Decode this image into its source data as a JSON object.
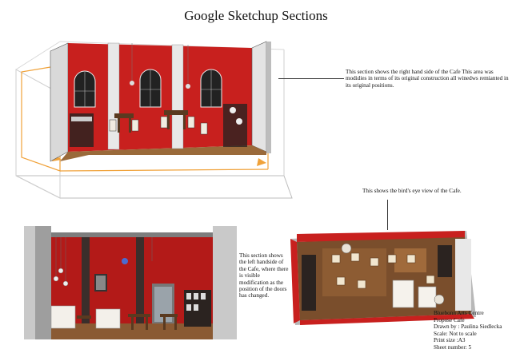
{
  "title": "Google Sketchup Sections",
  "annotations": {
    "right_section": "This section shows the right hand side of the Cafe This area was modidies in terms of its original construction all winedws remianted in its original positions.",
    "birds_eye": "This shows the bird's eye view of the  Cafe.",
    "left_section": "This section shows the left handside of the Cafe, where there is visible modification as the position of the doors has changed."
  },
  "info_block": {
    "lines": [
      "Bluebonn Arts Centre",
      "Propose Cafe",
      "Drawn by : Paulina Siedlecka",
      "Scale: Not to scale",
      "Print size :A3",
      "Sheet number: 5"
    ]
  },
  "colors": {
    "wall_red": "#c8201e",
    "floor_wood": "#8a5a33",
    "wall_grey": "#b9b9b9",
    "frame_dark": "#2b2320",
    "guide_orange": "#f0a23a"
  }
}
